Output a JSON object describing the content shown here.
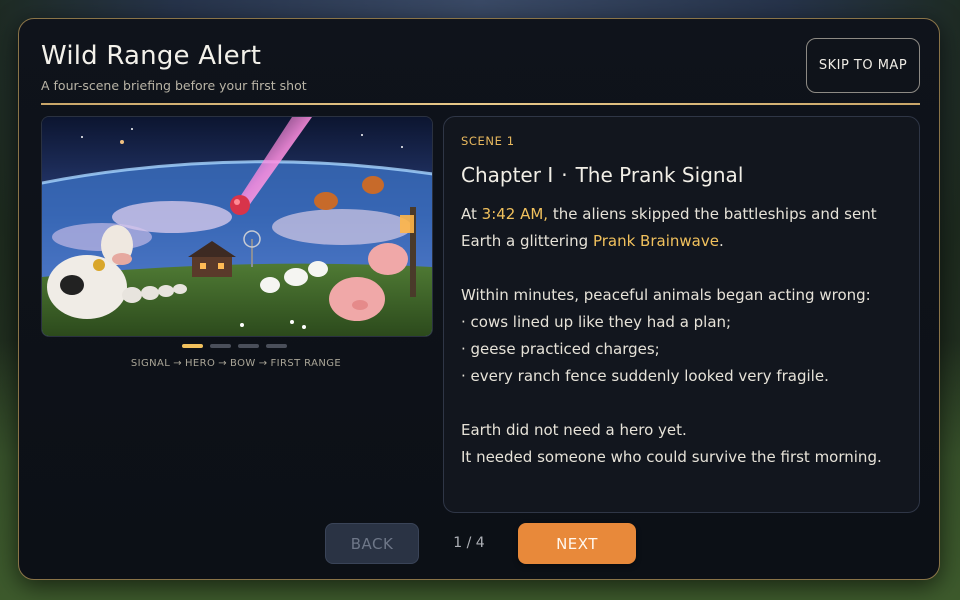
{
  "header": {
    "title": "Wild Range Alert",
    "subtitle": "A four-scene briefing before your first shot",
    "skip_label": "SKIP TO MAP"
  },
  "carousel": {
    "current_dot": 0,
    "total_dots": 4,
    "steps": [
      "SIGNAL",
      "HERO",
      "BOW",
      "FIRST RANGE"
    ],
    "arrow": "→"
  },
  "scene": {
    "label": "SCENE 1",
    "chapter_num": "Chapter I",
    "chapter_sep": "·",
    "chapter_title": "The Prank Signal",
    "p1_a": "At ",
    "p1_time": "3:42 AM,",
    "p1_b": " the aliens skipped the battleships and sent Earth a glittering ",
    "p1_hl": "Prank Brainwave",
    "p1_c": ".",
    "p2_intro": "Within minutes, peaceful animals began acting wrong:",
    "p2_items": [
      "· cows lined up like they had a plan;",
      "· geese practiced charges;",
      "· every ranch fence suddenly looked very fragile."
    ],
    "p3_line1": "Earth did not need a hero yet.",
    "p3_line2": "It needed someone who could survive the first morning."
  },
  "footer": {
    "back_label": "BACK",
    "page_count": "1 / 4",
    "next_label": "NEXT"
  },
  "colors": {
    "accent": "#f1c15d",
    "next_button": "#e8893a",
    "panel_border": "#8a7448"
  }
}
